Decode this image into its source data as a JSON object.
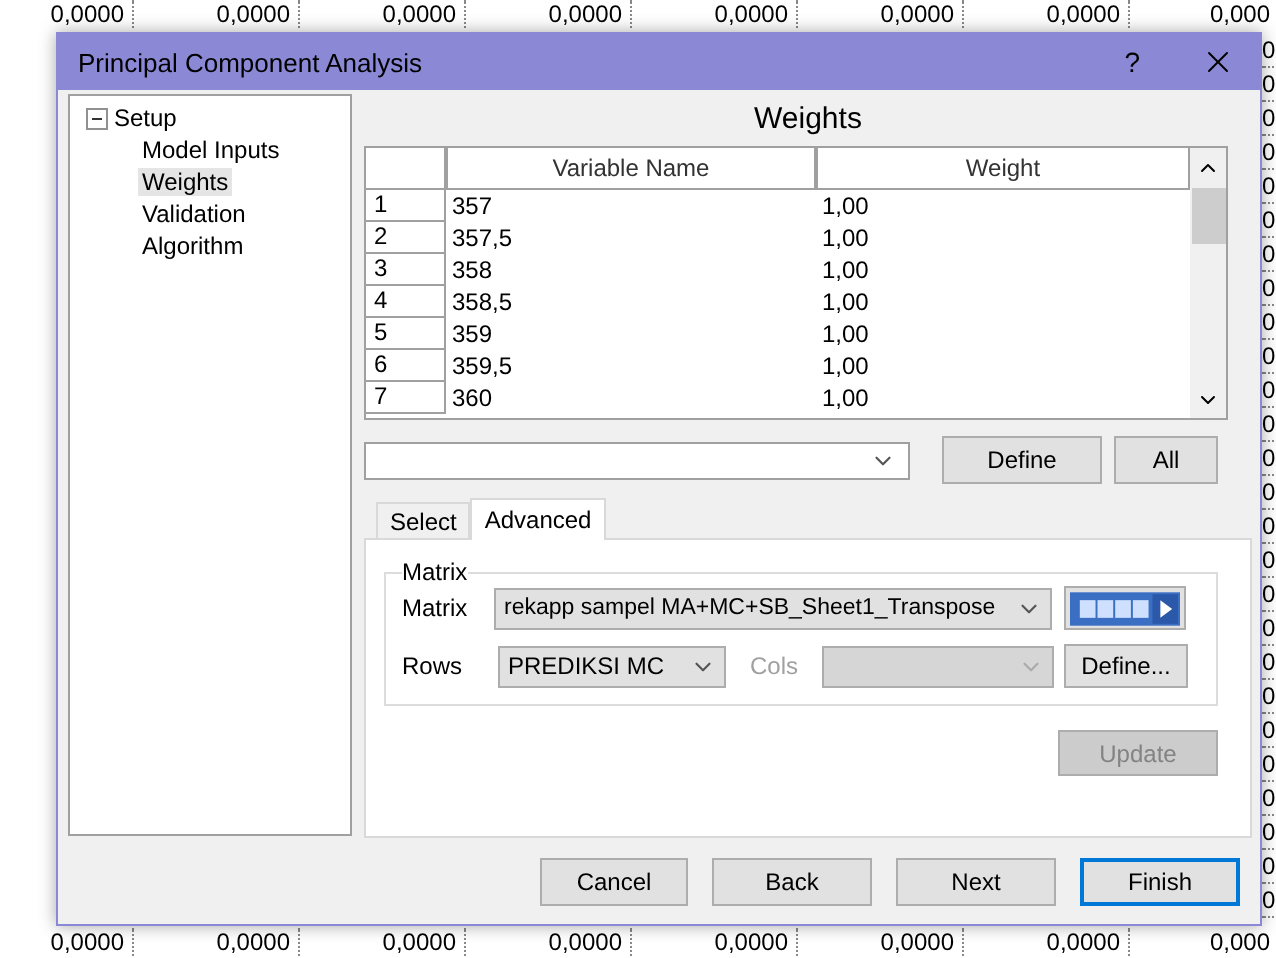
{
  "sheet": {
    "top_row": [
      "0,0000",
      "0,0000",
      "0,0000",
      "0,0000",
      "0,0000",
      "0,0000",
      "0,0000",
      "0,000"
    ],
    "right_column": [
      "0",
      "0",
      "0",
      "0",
      "0",
      "0",
      "0",
      "0",
      "0",
      "0",
      "0",
      "0",
      "0",
      "0",
      "0",
      "0",
      "0",
      "0",
      "0",
      "0",
      "0",
      "0",
      "0",
      "0",
      "0",
      "0"
    ],
    "bottom_row": [
      "0,0000",
      "0,0000",
      "0,0000",
      "0,0000",
      "0,0000",
      "0,0000",
      "0,0000",
      "0,000"
    ]
  },
  "window": {
    "title": "Principal Component Analysis",
    "help": "?"
  },
  "tree": {
    "label": "Setup",
    "expanded": true,
    "children": [
      {
        "label": "Model Inputs",
        "selected": false
      },
      {
        "label": "Weights",
        "selected": true
      },
      {
        "label": "Validation",
        "selected": false
      },
      {
        "label": "Algorithm",
        "selected": false
      }
    ]
  },
  "page_title": "Weights",
  "grid": {
    "columns": [
      "Variable Name",
      "Weight"
    ],
    "rows": [
      {
        "index": "1",
        "name": "357",
        "weight": "1,00"
      },
      {
        "index": "2",
        "name": "357,5",
        "weight": "1,00"
      },
      {
        "index": "3",
        "name": "358",
        "weight": "1,00"
      },
      {
        "index": "4",
        "name": "358,5",
        "weight": "1,00"
      },
      {
        "index": "5",
        "name": "359",
        "weight": "1,00"
      },
      {
        "index": "6",
        "name": "359,5",
        "weight": "1,00"
      },
      {
        "index": "7",
        "name": "360",
        "weight": "1,00"
      }
    ]
  },
  "filter": {
    "define_button": "Define",
    "all_button": "All"
  },
  "tabs": [
    {
      "label": "Select",
      "selected": false
    },
    {
      "label": "Advanced",
      "selected": true
    }
  ],
  "matrix_group": {
    "title": "Matrix",
    "matrix_label": "Matrix",
    "matrix_value": "rekapp sampel MA+MC+SB_Sheet1_Transpose",
    "rows_label": "Rows",
    "rows_value": "PREDIKSI MC",
    "cols_label": "Cols",
    "cols_disabled": true,
    "define_button": "Define..."
  },
  "update_button": {
    "label": "Update",
    "disabled": true
  },
  "buttons": [
    {
      "label": "Cancel",
      "default": false
    },
    {
      "label": "Back",
      "default": false
    },
    {
      "label": "Next",
      "default": false
    },
    {
      "label": "Finish",
      "default": true
    }
  ]
}
